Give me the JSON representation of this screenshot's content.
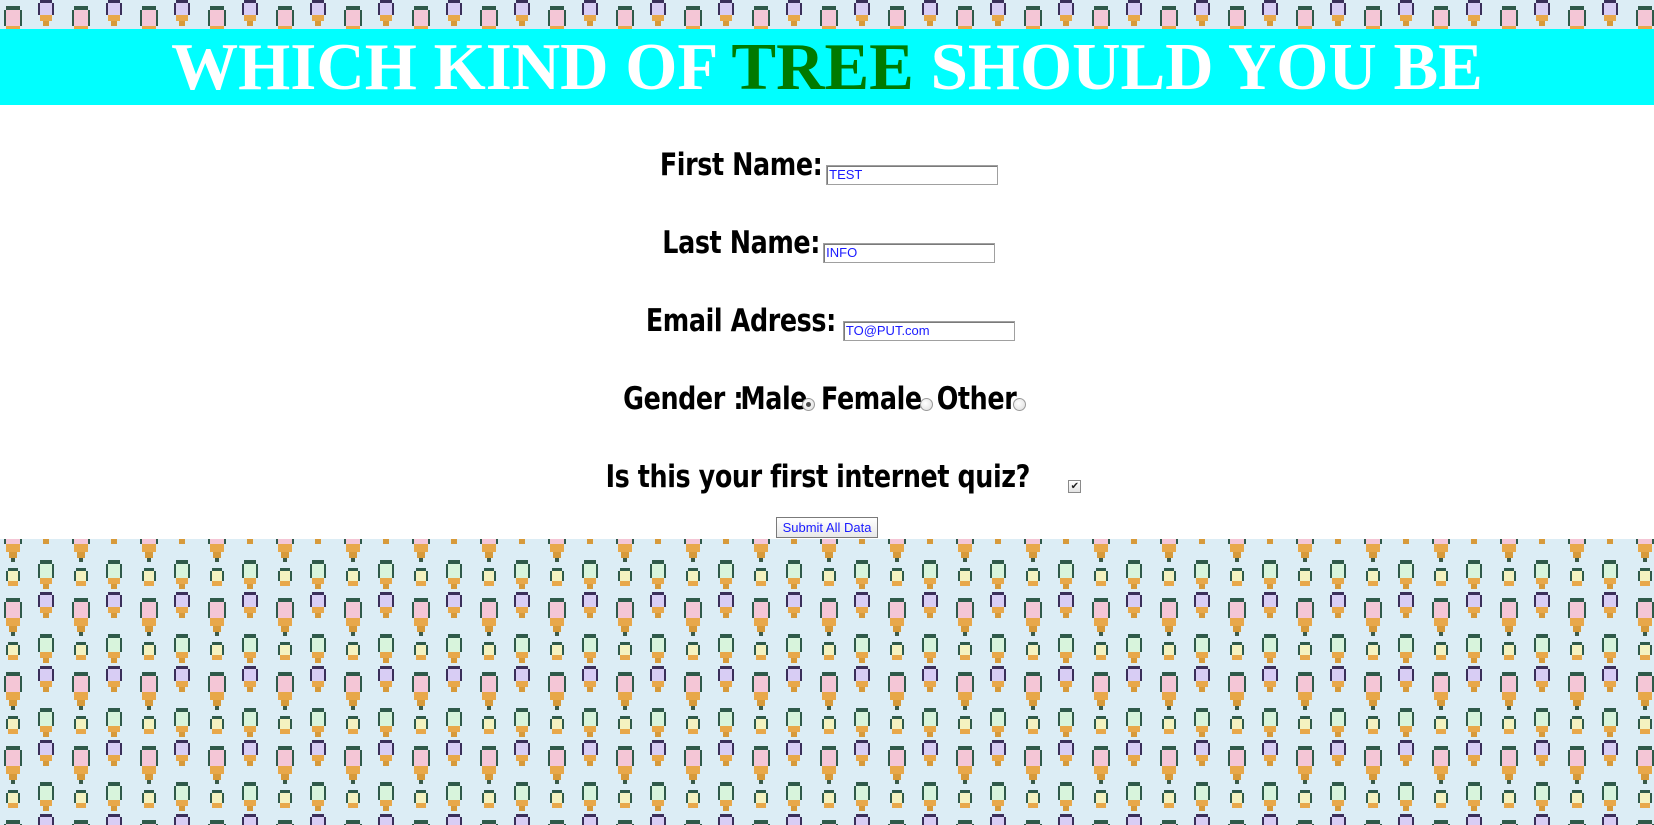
{
  "header": {
    "title_before": "WHICH KIND OF",
    "title_accent": "TREE",
    "title_after": "SHOULD YOU BE",
    "accent_color": "#007a00",
    "banner_color": "#00ffff"
  },
  "form": {
    "first_name": {
      "label": "First Name:",
      "value": "TEST"
    },
    "last_name": {
      "label": "Last Name:",
      "value": "INFO"
    },
    "email": {
      "label": "Email Adress:",
      "value": "TO@PUT.com"
    },
    "gender": {
      "label": "Gender :",
      "options": [
        {
          "label": "Male",
          "checked": true
        },
        {
          "label": "Female",
          "checked": false
        },
        {
          "label": "Other",
          "checked": false
        }
      ]
    },
    "first_quiz": {
      "label": "Is this your first internet quiz?",
      "checked": true
    },
    "submit_label": "Submit All Data"
  },
  "background": {
    "pattern": "pixel-ice-cream-cones",
    "base_color": "#dcedf5"
  }
}
